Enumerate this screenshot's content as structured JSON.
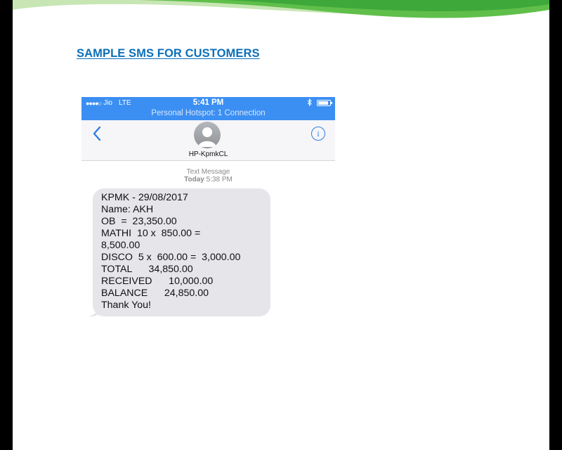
{
  "slide": {
    "title": "SAMPLE SMS FOR CUSTOMERS",
    "colors": {
      "title": "#0b6fb8",
      "accent_green": "#5fbf4a",
      "accent_lightgreen": "#c7e6b4",
      "accent_blue": "#3c8ff2"
    }
  },
  "status_bar": {
    "signal_dots": "●●●●○",
    "carrier": "Jio",
    "network": "LTE",
    "time": "5:41 PM",
    "hotspot": "Personal Hotspot: 1 Connection",
    "bluetooth_icon": "bluetooth-icon",
    "battery_icon": "battery-icon"
  },
  "nav": {
    "back_icon": "chevron-left-icon",
    "info_icon": "info-icon",
    "contact_name": "HP-KpmkCL"
  },
  "thread": {
    "meta_label": "Text Message",
    "meta_day": "Today",
    "meta_time": "5:38 PM",
    "message_lines": [
      "KPMK - 29/08/2017",
      "Name: AKH",
      "OB  =  23,350.00",
      "MATHI  10 x  850.00 =",
      "8,500.00",
      "DISCO  5 x  600.00 =  3,000.00",
      "TOTAL      34,850.00",
      "RECEIVED      10,000.00",
      "BALANCE      24,850.00",
      "Thank You!"
    ]
  }
}
